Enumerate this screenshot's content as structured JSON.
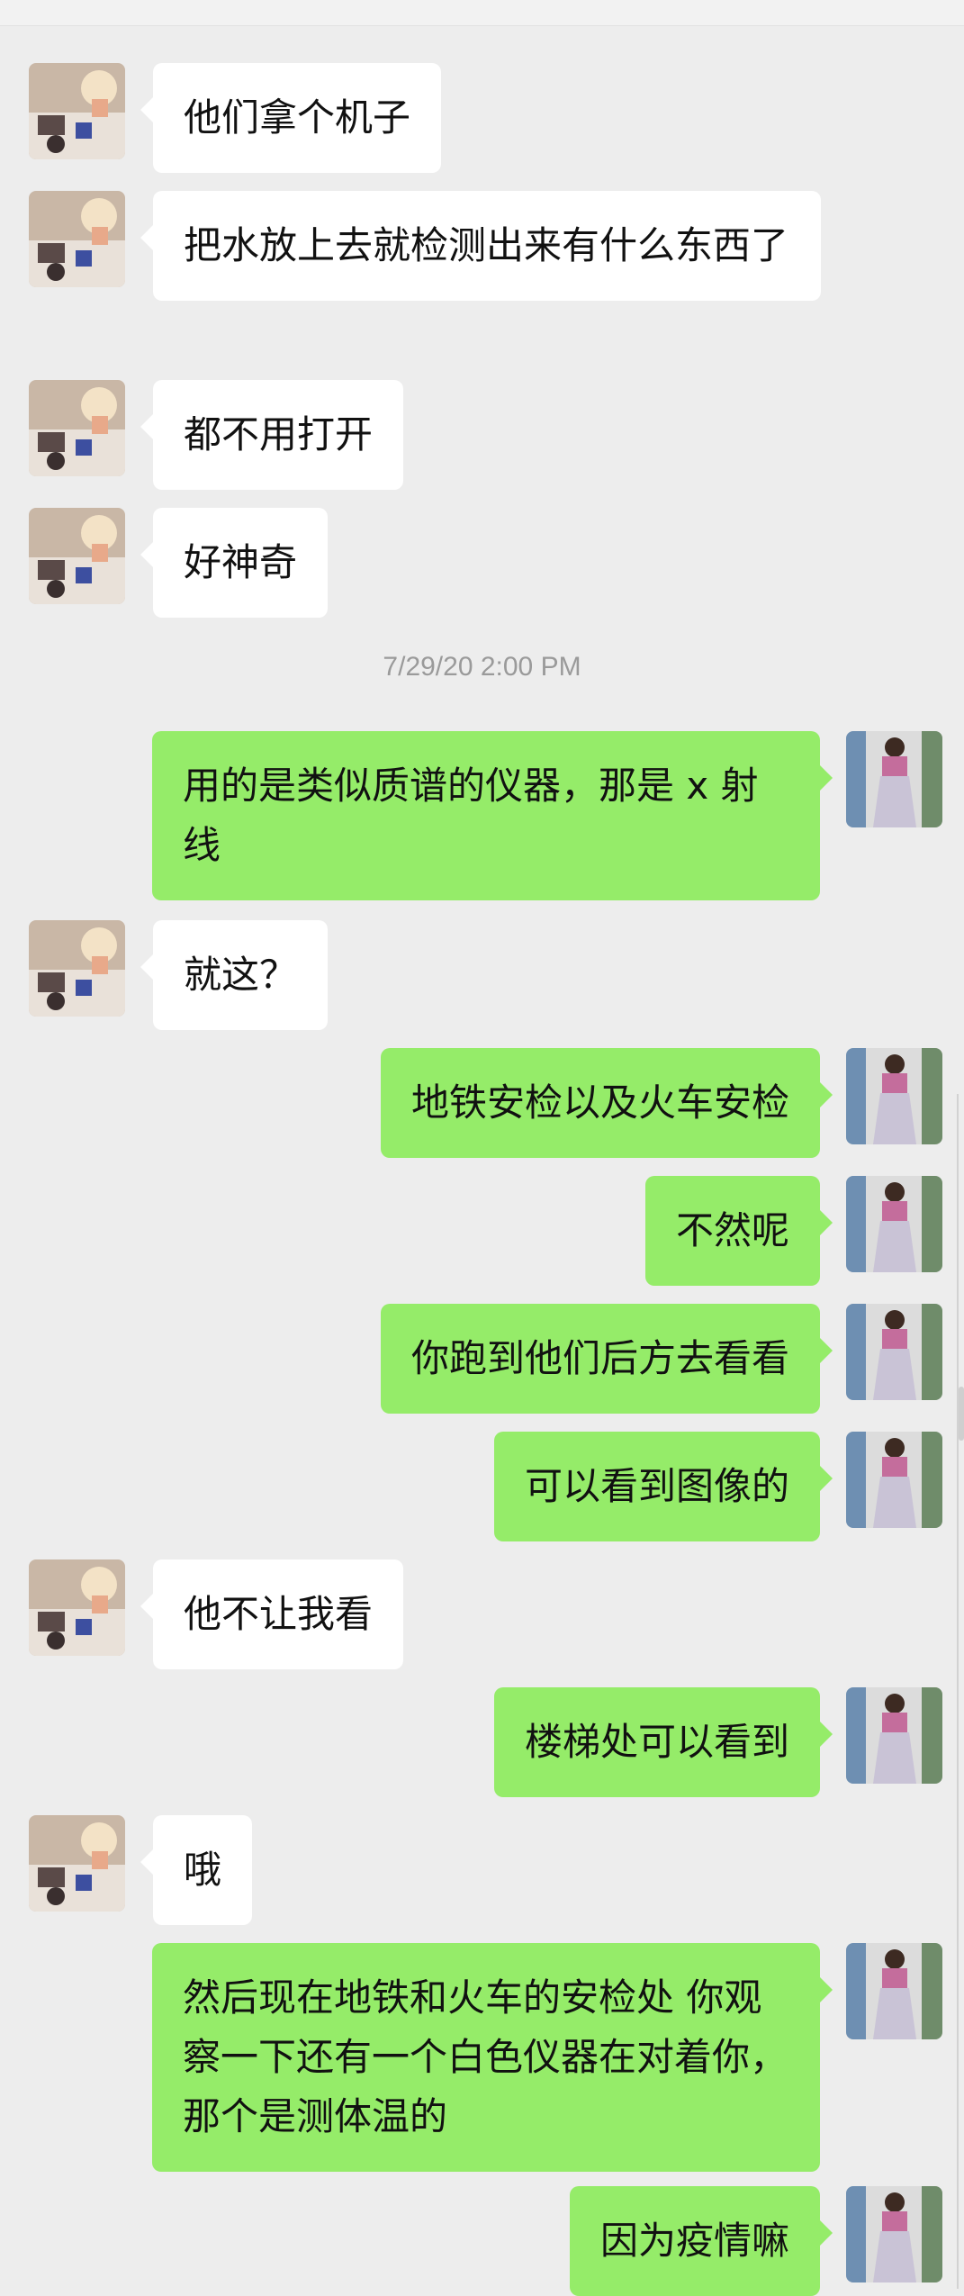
{
  "timestamp": "7/29/20 2:00 PM",
  "avatars": {
    "contact": "contact-avatar-photo",
    "self": "self-avatar-photo"
  },
  "messages": [
    {
      "from": "contact",
      "text": "他们拿个机子"
    },
    {
      "from": "contact",
      "text": "把水放上去就检测出来有什么东西了"
    },
    {
      "from": "contact",
      "text": "都不用打开"
    },
    {
      "from": "contact",
      "text": "好神奇"
    },
    {
      "from": "self",
      "text": "用的是类似质谱的仪器，那是 x 射线"
    },
    {
      "from": "contact",
      "text": "就这？"
    },
    {
      "from": "self",
      "text": "地铁安检以及火车安检"
    },
    {
      "from": "self",
      "text": "不然呢"
    },
    {
      "from": "self",
      "text": "你跑到他们后方去看看"
    },
    {
      "from": "self",
      "text": "可以看到图像的"
    },
    {
      "from": "contact",
      "text": "他不让我看"
    },
    {
      "from": "self",
      "text": "楼梯处可以看到"
    },
    {
      "from": "contact",
      "text": "哦"
    },
    {
      "from": "self",
      "text": "然后现在地铁和火车的安检处 你观察一下还有一个白色仪器在对着你，那个是测体温的"
    },
    {
      "from": "self",
      "text": "因为疫情嘛"
    }
  ]
}
